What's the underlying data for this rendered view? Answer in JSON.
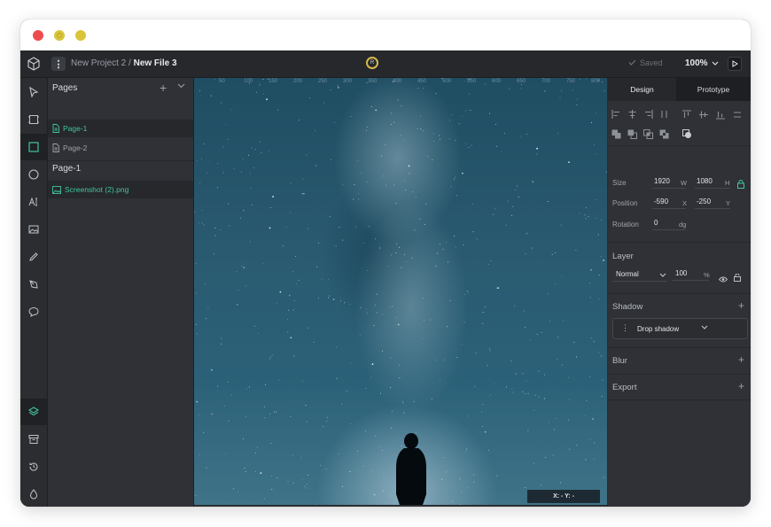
{
  "window": {
    "controls": [
      "close",
      "minimize",
      "maximize"
    ]
  },
  "topbar": {
    "logo": "cube-logo-icon",
    "menu_icon": "kebab-menu-icon",
    "project_name": "New Project 2",
    "separator": " / ",
    "file_name": "New File 3",
    "avatar_initial": "R",
    "saved_label": "Saved",
    "zoom_label": "100%",
    "play_icon": "play-icon"
  },
  "toolbar": {
    "tools": [
      {
        "name": "select-tool",
        "icon": "cursor-icon"
      },
      {
        "name": "frame-tool",
        "icon": "frame-icon"
      },
      {
        "name": "rectangle-tool",
        "icon": "rectangle-icon",
        "active": true
      },
      {
        "name": "ellipse-tool",
        "icon": "ellipse-icon"
      },
      {
        "name": "text-tool",
        "icon": "text-icon"
      },
      {
        "name": "image-tool",
        "icon": "image-icon"
      },
      {
        "name": "pencil-tool",
        "icon": "pencil-icon"
      },
      {
        "name": "path-tool",
        "icon": "pen-nib-icon"
      },
      {
        "name": "comment-tool",
        "icon": "comment-icon"
      }
    ],
    "bottom": [
      {
        "name": "layers-toggle",
        "icon": "layers-icon",
        "active": true
      },
      {
        "name": "assets-toggle",
        "icon": "archive-icon"
      },
      {
        "name": "history-toggle",
        "icon": "history-icon"
      },
      {
        "name": "color-toggle",
        "icon": "droplet-icon"
      }
    ]
  },
  "layers": {
    "title": "Pages",
    "pages": [
      {
        "label": "Page-1",
        "selected": true
      },
      {
        "label": "Page-2",
        "selected": false
      }
    ],
    "current_page": "Page-1",
    "items": [
      {
        "label": "Screenshot (2).png"
      }
    ]
  },
  "canvas": {
    "ruler": [
      "50",
      "100",
      "150",
      "200",
      "250",
      "300",
      "350",
      "400",
      "450",
      "500",
      "550",
      "600",
      "650",
      "700",
      "750",
      "800"
    ],
    "coords_label": "X: - Y: -"
  },
  "props": {
    "tabs": [
      "Design",
      "Prototype"
    ],
    "size_label": "Size",
    "width": "1920",
    "width_unit": "W",
    "height": "1080",
    "height_unit": "H",
    "position_label": "Position",
    "x": "-590",
    "x_unit": "X",
    "y": "-250",
    "y_unit": "Y",
    "rotation_label": "Rotation",
    "rotation": "0",
    "rotation_unit": "dg",
    "layer_section": "Layer",
    "blend_mode": "Normal",
    "opacity": "100",
    "opacity_unit": "%",
    "shadow_section": "Shadow",
    "shadow_type": "Drop shadow",
    "blur_section": "Blur",
    "export_section": "Export"
  },
  "colors": {
    "accent": "#43c49e",
    "panel": "#2f3136",
    "toolbar": "#2b2d31",
    "topbar": "#26282c"
  }
}
